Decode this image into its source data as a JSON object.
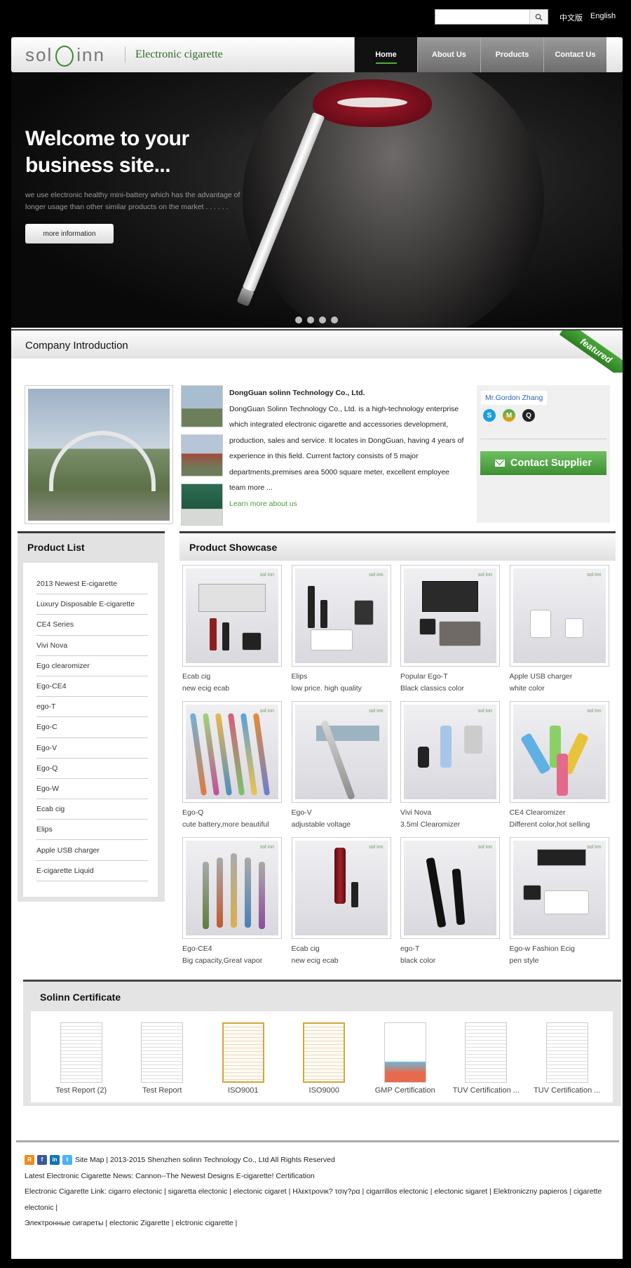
{
  "top": {
    "search_placeholder": "",
    "lang_cn": "中文版",
    "lang_en": "English"
  },
  "header": {
    "logo_left": "sol",
    "logo_right": "inn",
    "logo_sub": "Electronic cigarette",
    "nav": [
      "Home",
      "About Us",
      "Products",
      "Contact Us"
    ]
  },
  "hero": {
    "title": "Welcome to your business site...",
    "desc": "we use electronic healthy mini-battery which has the advantage of longer usage than other similar products on the market . . . . . .",
    "button": "more information",
    "slides_total": 4
  },
  "intro": {
    "title": "Company Introduction",
    "ribbon": "featured",
    "company": "DongGuan solinn Technology Co., Ltd.",
    "body": "DongGuan Solinn Technology Co., Ltd. is a high-technology enterprise which integrated electronic cigarette and accessories development, production, sales and service. It locates in DongGuan, having 4 years of experience in this field. Current factory consists of 5 major departments,premises area 5000 square meter, excellent employee team more ...",
    "more": "Learn more about us",
    "contact_name": "Mr.Gordon Zhang",
    "contact_button": "Contact Supplier"
  },
  "product_list": {
    "title": "Product List",
    "items": [
      "2013 Newest E-cigarette",
      "Luxury Disposable E-cigarette",
      "CE4 Series",
      "Vivi Nova",
      "Ego clearomizer",
      "Ego-CE4",
      "ego-T",
      "Ego-C",
      "Ego-V",
      "Ego-Q",
      "Ego-W",
      "Ecab cig",
      "Elips",
      "Apple USB charger",
      "E-cigarette Liquid"
    ]
  },
  "showcase": {
    "title": "Product Showcase",
    "watermark": "sol inn",
    "products": [
      {
        "name": "Ecab cig",
        "desc": "new ecig ecab"
      },
      {
        "name": "Elips",
        "desc": "low price. high quality"
      },
      {
        "name": "Popular Ego-T",
        "desc": "Black classics color"
      },
      {
        "name": "Apple USB charger",
        "desc": "white color"
      },
      {
        "name": "Ego-Q",
        "desc": "cute battery,more beautiful"
      },
      {
        "name": "Ego-V",
        "desc": "adjustable voltage"
      },
      {
        "name": "Vivi Nova",
        "desc": "3.5ml Clearomizer"
      },
      {
        "name": "CE4 Clearomizer",
        "desc": "Different color,hot selling"
      },
      {
        "name": "Ego-CE4",
        "desc": "Big capacity,Great vapor"
      },
      {
        "name": "Ecab cig",
        "desc": "new ecig ecab"
      },
      {
        "name": "ego-T",
        "desc": "black color"
      },
      {
        "name": "Ego-w Fashion Ecig",
        "desc": "pen style"
      }
    ]
  },
  "certificate": {
    "title": "Solinn Certificate",
    "items": [
      "Test Report (2)",
      "Test Report",
      "ISO9001",
      "ISO9000",
      "GMP Certification",
      "TUV Certification ...",
      "TUV Certification ..."
    ]
  },
  "footer": {
    "line1": "Site Map | 2013-2015 Shenzhen solinn Technology Co., Ltd All Rights Reserved",
    "line2": "Latest Electronic Cigarette News: Cannon--The Newest Designs E-cigarette! Certification",
    "line3": "Electronic Cigarette Link: cigarro electonic | sigaretta electonic | electonic cigaret | Ηλεκτρονικ? τσιγ?ρα | cigarrillos electonic | electonic sigaret | Elektroniczny papieros | cigarette electonic |",
    "line4": "Электронные сигареты | electonic Zigarette | elctronic cigarette |"
  }
}
